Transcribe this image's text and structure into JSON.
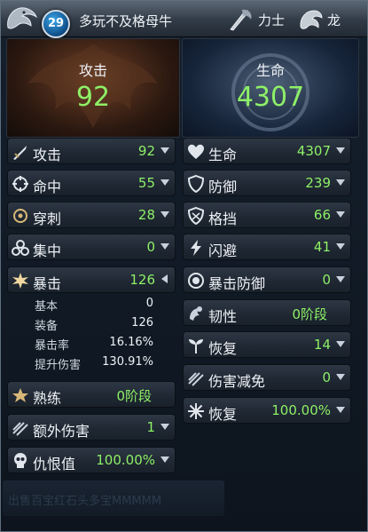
{
  "header": {
    "level": "29",
    "player_name": "多玩不及格母牛",
    "class_label": "力士",
    "race_label": "龙"
  },
  "banners": {
    "attack": {
      "title": "攻击",
      "value": "92"
    },
    "hp": {
      "title": "生命",
      "value": "4307"
    }
  },
  "left_stats": [
    {
      "label": "攻击",
      "value": "92",
      "icon": "sword-icon"
    },
    {
      "label": "命中",
      "value": "55",
      "icon": "crosshair-icon"
    },
    {
      "label": "穿刺",
      "value": "28",
      "icon": "pierce-icon"
    },
    {
      "label": "集中",
      "value": "0",
      "icon": "focus-icon"
    },
    {
      "label": "暴击",
      "value": "126",
      "icon": "burst-icon"
    }
  ],
  "crit_details": [
    {
      "label": "基本",
      "value": "0"
    },
    {
      "label": "装备",
      "value": "126"
    },
    {
      "label": "暴击率",
      "value": "16.16%"
    },
    {
      "label": "提升伤害",
      "value": "130.91%"
    }
  ],
  "left_stats_bottom": [
    {
      "label": "熟练",
      "value": "0阶段",
      "icon": "mastery-icon"
    },
    {
      "label": "额外伤害",
      "value": "1",
      "icon": "extra-damage-icon"
    },
    {
      "label": "仇恨值",
      "value": "100.00%",
      "icon": "skull-icon"
    }
  ],
  "right_stats": [
    {
      "label": "生命",
      "value": "4307",
      "icon": "heart-icon"
    },
    {
      "label": "防御",
      "value": "239",
      "icon": "shield-icon"
    },
    {
      "label": "格挡",
      "value": "66",
      "icon": "block-icon"
    },
    {
      "label": "闪避",
      "value": "41",
      "icon": "evade-icon"
    },
    {
      "label": "暴击防御",
      "value": "0",
      "icon": "crit-defense-icon"
    },
    {
      "label": "韧性",
      "value": "0阶段",
      "icon": "toughness-icon"
    },
    {
      "label": "恢复",
      "value": "14",
      "icon": "regen-icon"
    },
    {
      "label": "伤害减免",
      "value": "0",
      "icon": "damage-reduction-icon"
    },
    {
      "label": "恢复",
      "value": "100.00%",
      "icon": "recovery-icon"
    }
  ],
  "footer": {
    "text": "出售百宝红石头多宝MMMMM"
  },
  "colors": {
    "value_green": "#8ef067",
    "text_white": "#eef2f6",
    "panel_dark": "#1f2833"
  }
}
